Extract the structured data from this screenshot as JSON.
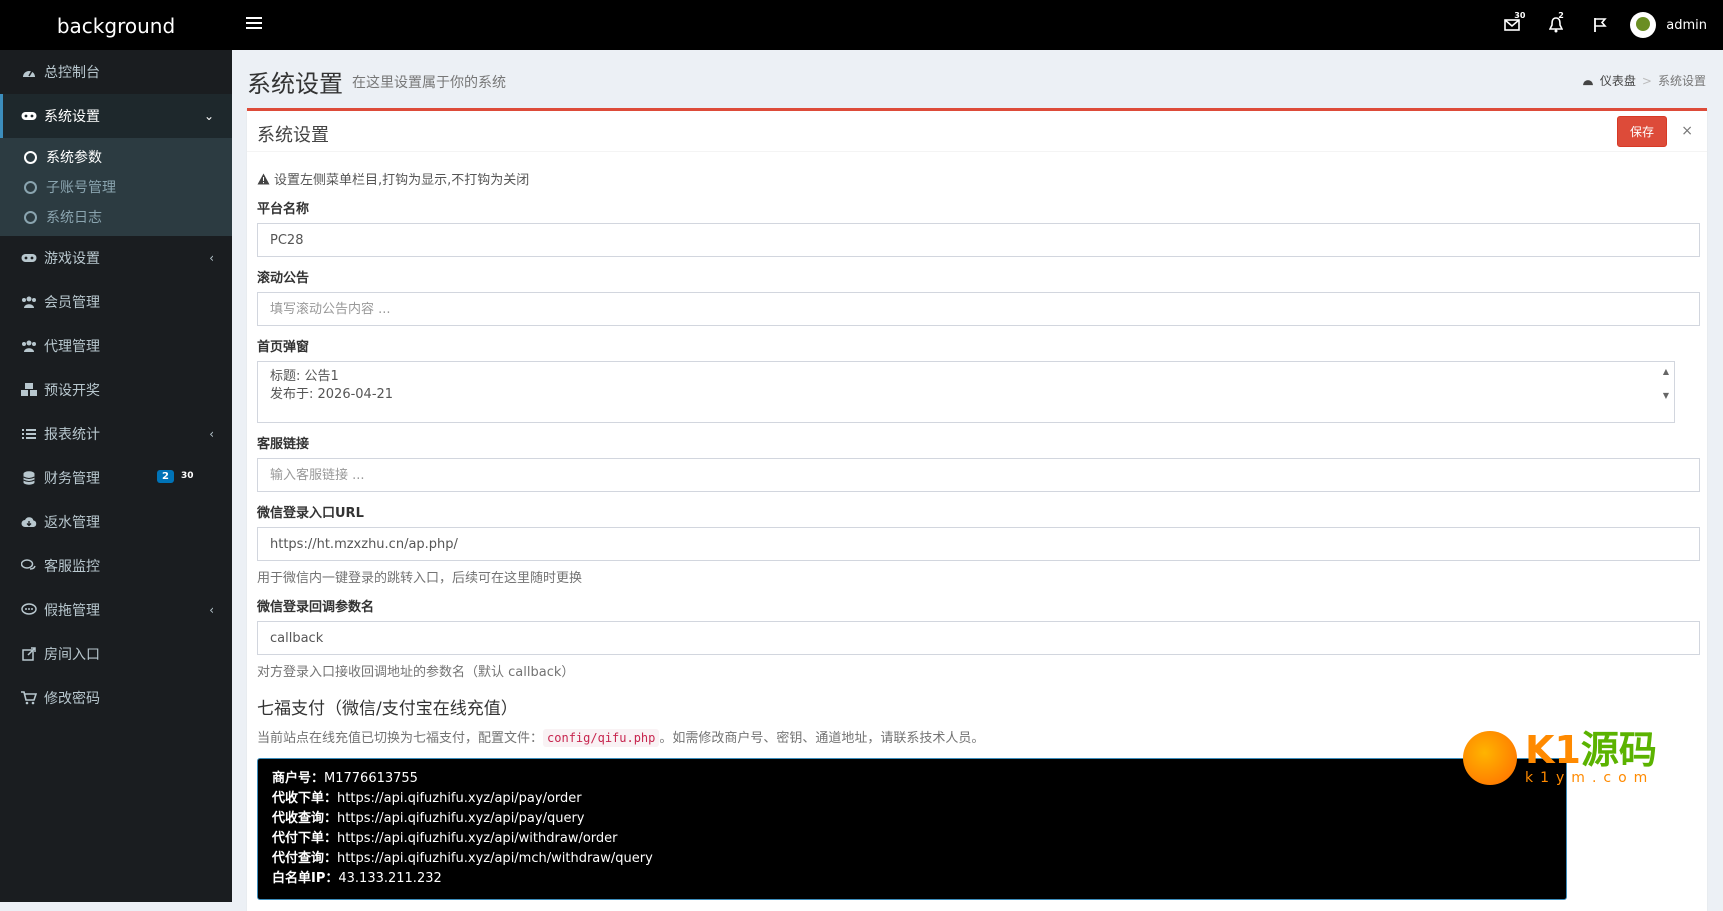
{
  "brand": "background",
  "topbar": {
    "mail_count": "30",
    "bell_count": "2",
    "user_name": "admin"
  },
  "sidebar": {
    "items": [
      {
        "label": "总控制台"
      },
      {
        "label": "系统设置"
      },
      {
        "label": "游戏设置"
      },
      {
        "label": "会员管理"
      },
      {
        "label": "代理管理"
      },
      {
        "label": "预设开奖"
      },
      {
        "label": "报表统计"
      },
      {
        "label": "财务管理",
        "badge1": "2",
        "badge2": "30"
      },
      {
        "label": "返水管理"
      },
      {
        "label": "客服监控"
      },
      {
        "label": "假拖管理"
      },
      {
        "label": "房间入口"
      },
      {
        "label": "修改密码"
      }
    ],
    "submenu": [
      {
        "label": "系统参数"
      },
      {
        "label": "子账号管理"
      },
      {
        "label": "系统日志"
      }
    ]
  },
  "header": {
    "title": "系统设置",
    "subtitle": "在这里设置属于你的系统",
    "breadcrumb_home": "仪表盘",
    "breadcrumb_current": "系统设置"
  },
  "box": {
    "title": "系统设置",
    "save_label": "保存",
    "close_label": "×"
  },
  "form": {
    "hint": "设置左侧菜单栏目,打钩为显示,不打钩为关闭",
    "platform_label": "平台名称",
    "platform_value": "PC28",
    "notice_label": "滚动公告",
    "notice_placeholder": "填写滚动公告内容 ...",
    "popup_label": "首页弹窗",
    "popup_line1": "标题: 公告1",
    "popup_line2": "发布于: 2026-04-21",
    "cs_label": "客服链接",
    "cs_placeholder": "输入客服链接 ...",
    "wx_url_label": "微信登录入口URL",
    "wx_url_value": "https://ht.mzxzhu.cn/ap.php/",
    "wx_url_help": "用于微信内一键登录的跳转入口，后续可在这里随时更换",
    "wx_cb_label": "微信登录回调参数名",
    "wx_cb_value": "callback",
    "wx_cb_help": "对方登录入口接收回调地址的参数名（默认 callback）"
  },
  "qifu": {
    "heading": "七福支付（微信/支付宝在线充值）",
    "desc_before": "当前站点在线充值已切换为七福支付，配置文件：",
    "config_file": "config/qifu.php",
    "desc_after": "。如需修改商户号、密钥、通道地址，请联系技术人员。",
    "lines": [
      {
        "key": "商户号：",
        "val": "M1776613755"
      },
      {
        "key": "代收下单：",
        "val": "https://api.qifuzhifu.xyz/api/pay/order"
      },
      {
        "key": "代收查询：",
        "val": "https://api.qifuzhifu.xyz/api/pay/query"
      },
      {
        "key": "代付下单：",
        "val": "https://api.qifuzhifu.xyz/api/withdraw/order"
      },
      {
        "key": "代付查询：",
        "val": "https://api.qifuzhifu.xyz/api/mch/withdraw/query"
      },
      {
        "key": "白名单IP：",
        "val": "43.133.211.232"
      }
    ]
  },
  "watermark": {
    "text_a": "K1",
    "text_b": "源码",
    "url": "k1ym.com"
  },
  "colors": {
    "accent_red": "#dd4b39",
    "sidebar_bg": "#1a1d20",
    "badge_blue": "#0073b7"
  }
}
